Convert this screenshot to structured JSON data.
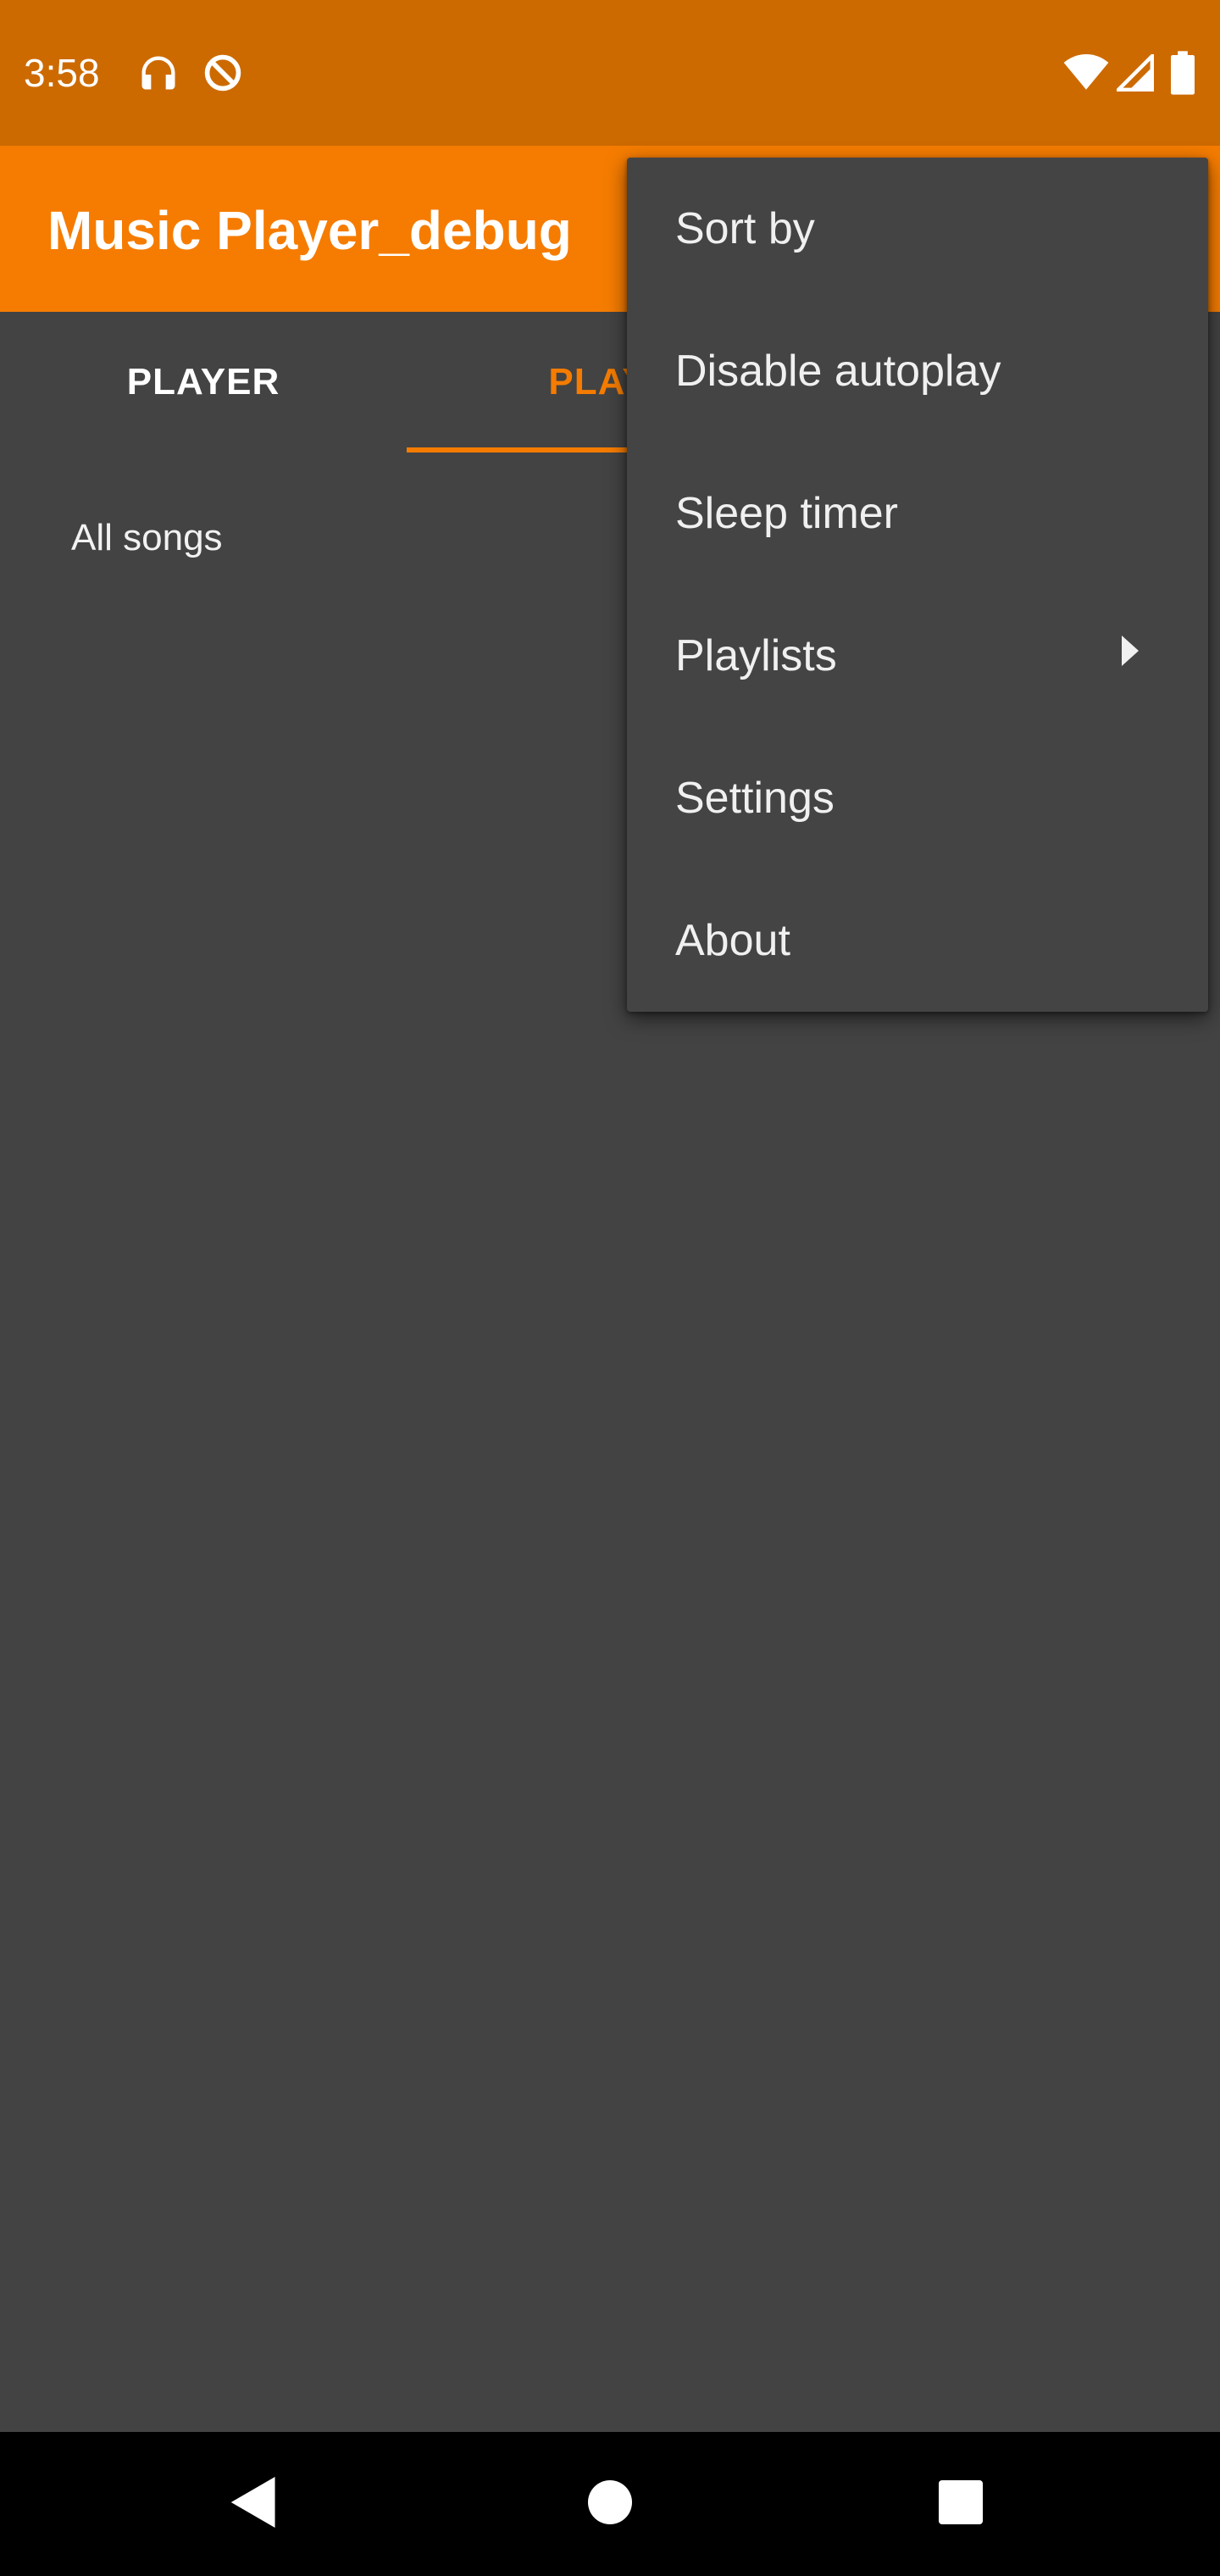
{
  "status_bar": {
    "time": "3:58",
    "left_icons": [
      "headphones-icon",
      "data-saver-icon"
    ],
    "right_icons": [
      "wifi-icon",
      "cell-signal-icon",
      "battery-icon"
    ]
  },
  "toolbar": {
    "title": "Music Player_debug",
    "color": "#f57c00"
  },
  "tabs": [
    {
      "label": "PLAYER",
      "selected": false
    },
    {
      "label": "PLAYL",
      "selected": true
    }
  ],
  "content": {
    "items": [
      {
        "label": "All songs"
      }
    ]
  },
  "overflow_menu": {
    "items": [
      {
        "label": "Sort by"
      },
      {
        "label": "Disable autoplay"
      },
      {
        "label": "Sleep timer"
      },
      {
        "label": "Playlists",
        "has_submenu": true
      },
      {
        "label": "Settings"
      },
      {
        "label": "About"
      }
    ]
  },
  "nav_bar": {
    "buttons": [
      "back-icon",
      "home-icon",
      "recents-icon"
    ]
  },
  "colors": {
    "status_bar": "#cc6a00",
    "accent": "#f57c00",
    "background": "#434343",
    "menu_background": "#444444"
  }
}
